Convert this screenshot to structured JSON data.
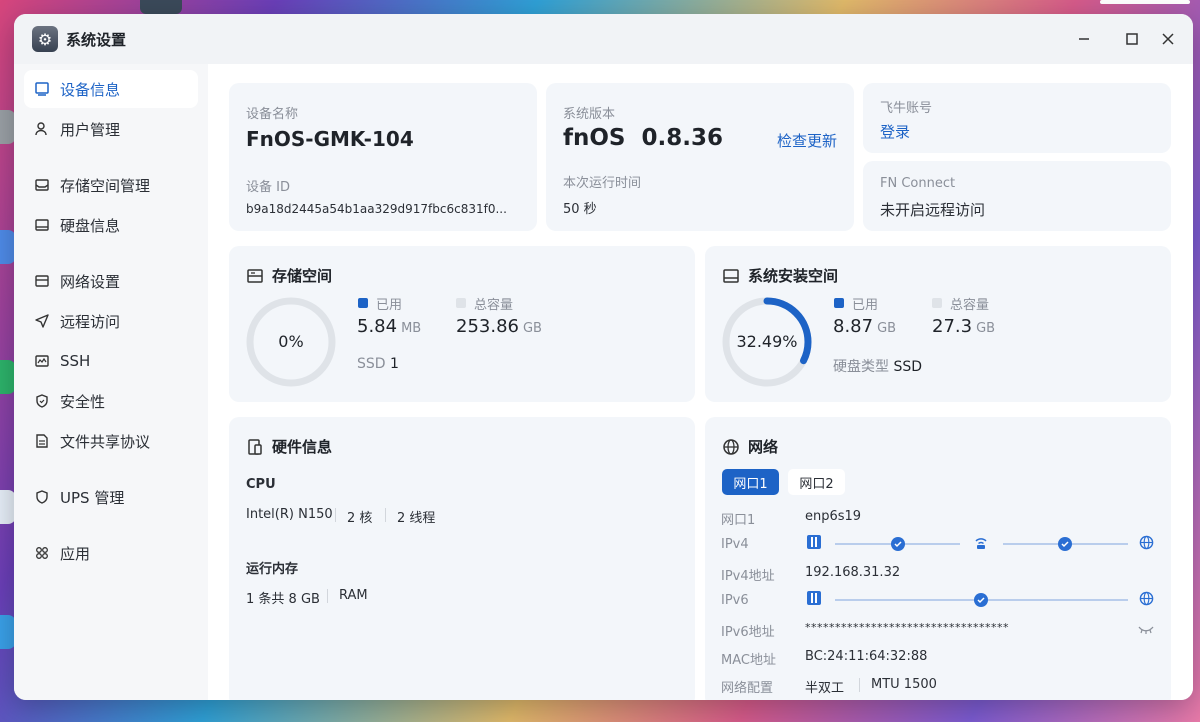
{
  "window": {
    "title": "系统设置"
  },
  "sidebar": {
    "items": [
      {
        "label": "设备信息"
      },
      {
        "label": "用户管理"
      },
      {
        "label": "存储空间管理"
      },
      {
        "label": "硬盘信息"
      },
      {
        "label": "网络设置"
      },
      {
        "label": "远程访问"
      },
      {
        "label": "SSH"
      },
      {
        "label": "安全性"
      },
      {
        "label": "文件共享协议"
      },
      {
        "label": "UPS 管理"
      },
      {
        "label": "应用"
      }
    ]
  },
  "device": {
    "name_label": "设备名称",
    "name": "FnOS-GMK-104",
    "id_label": "设备 ID",
    "id": "b9a18d2445a54b1aa329d917fbc6c831f0..."
  },
  "system": {
    "version_label": "系统版本",
    "version": "fnOS  0.8.36",
    "check_update": "检查更新",
    "uptime_label": "本次运行时间",
    "uptime": "50 秒"
  },
  "account": {
    "label": "飞牛账号",
    "login": "登录"
  },
  "fn_connect": {
    "label": "FN Connect",
    "status": "未开启远程访问"
  },
  "storage": {
    "title": "存储空间",
    "percent": "0%",
    "used_fraction": 0.0,
    "used_label": "已用",
    "used_value": "5.84",
    "used_unit": "MB",
    "total_label": "总容量",
    "total_value": "253.86",
    "total_unit": "GB",
    "disk_label": "SSD",
    "disk_count": "1"
  },
  "system_install": {
    "title": "系统安装空间",
    "percent": "32.49%",
    "used_fraction": 0.3249,
    "used_label": "已用",
    "used_value": "8.87",
    "used_unit": "GB",
    "total_label": "总容量",
    "total_value": "27.3",
    "total_unit": "GB",
    "disk_type_label": "硬盘类型",
    "disk_type": "SSD"
  },
  "hardware": {
    "title": "硬件信息",
    "cpu_label": "CPU",
    "cpu_model": "Intel(R) N150",
    "cores": "2 核",
    "threads": "2 线程",
    "mem_label": "运行内存",
    "mem_value": "1 条共 8 GB",
    "mem_type": "RAM"
  },
  "network": {
    "title": "网络",
    "tabs": [
      "网口1",
      "网口2"
    ],
    "rows": [
      {
        "label": "网口1",
        "value": "enp6s19"
      },
      {
        "label": "IPv4",
        "value": ""
      },
      {
        "label": "IPv4地址",
        "value": "192.168.31.32"
      },
      {
        "label": "IPv6",
        "value": ""
      },
      {
        "label": "IPv6地址",
        "value": "**********************************"
      },
      {
        "label": "MAC地址",
        "value": "BC:24:11:64:32:88"
      },
      {
        "label": "网络配置",
        "value": "半双工"
      }
    ],
    "mtu": "MTU 1500"
  },
  "colors": {
    "accent": "#1d63c6",
    "ring_track": "#dfe3e8",
    "card_bg": "#f3f6fa"
  }
}
